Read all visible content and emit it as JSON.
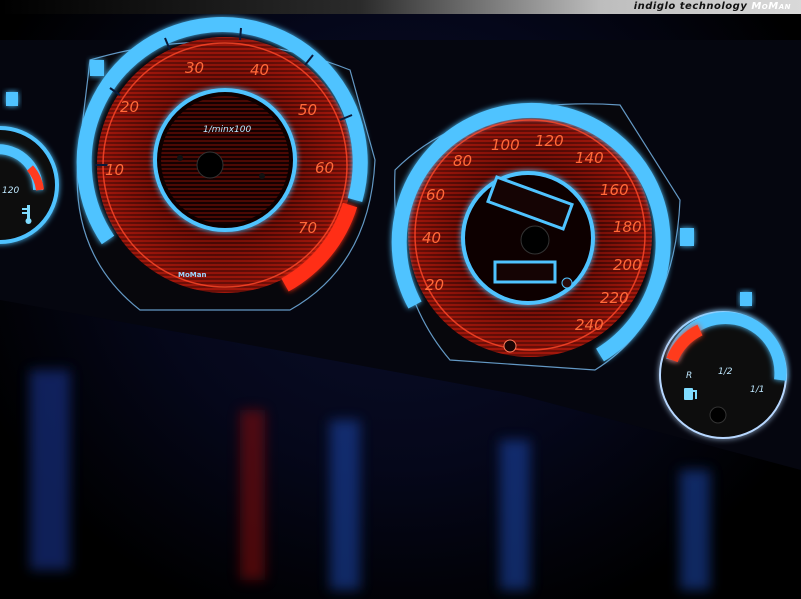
{
  "banner": {
    "text": "indiglo technology",
    "brand": "MoMan"
  },
  "tachometer": {
    "labels": [
      "10",
      "20",
      "30",
      "40",
      "50",
      "60",
      "70"
    ],
    "unit_label": "1/minx100",
    "logo": "MoMan"
  },
  "speedometer": {
    "labels": [
      "20",
      "40",
      "60",
      "80",
      "100",
      "120",
      "140",
      "160",
      "180",
      "200",
      "220",
      "240"
    ]
  },
  "fuel_gauge": {
    "labels": [
      "R",
      "1/2",
      "1/1"
    ]
  },
  "temp_gauge": {
    "label": "120"
  },
  "colors": {
    "glow_blue": "#4fc3ff",
    "needle_red": "#ff3b1f",
    "dial_red": "#c81a0e"
  },
  "icons": [
    "fuel-pump-icon",
    "coolant-temperature-icon"
  ]
}
